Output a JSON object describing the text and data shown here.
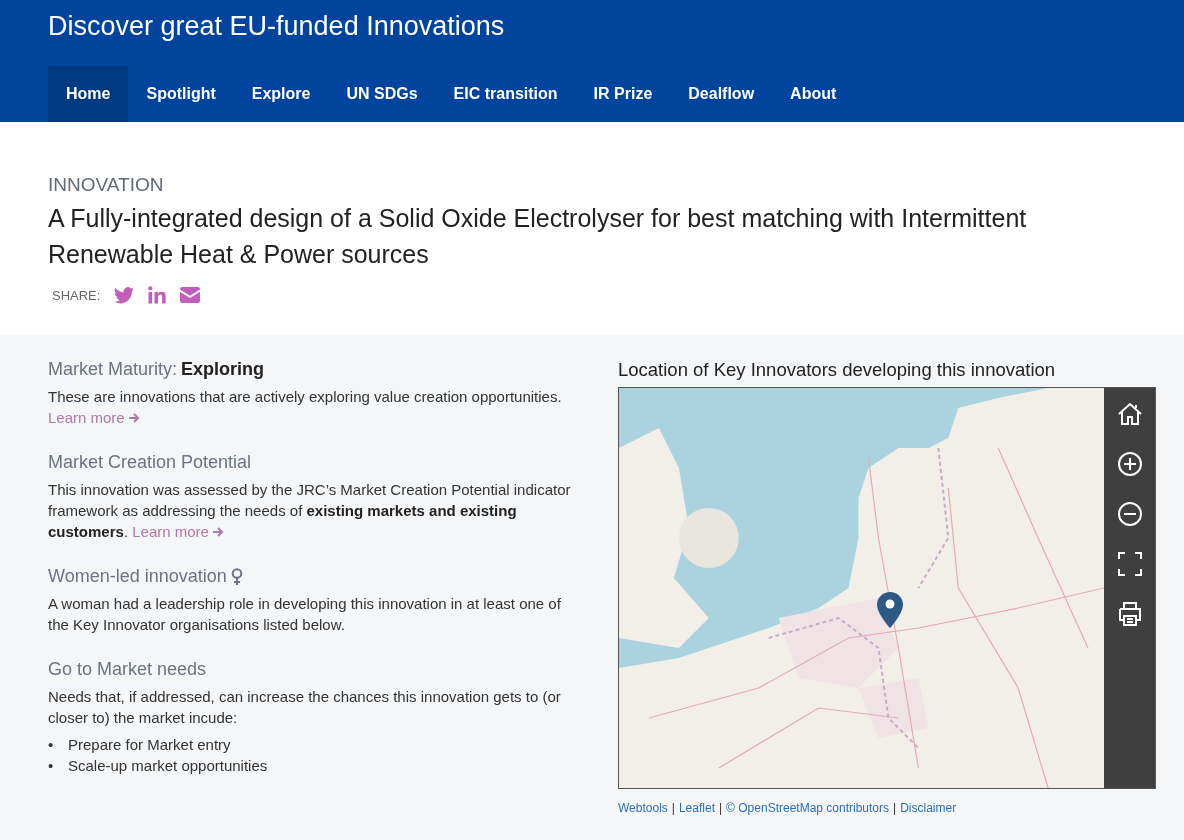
{
  "header": {
    "title": "Discover great EU-funded Innovations"
  },
  "nav": [
    {
      "label": "Home",
      "selected": true
    },
    {
      "label": "Spotlight",
      "selected": false
    },
    {
      "label": "Explore",
      "selected": false
    },
    {
      "label": "UN SDGs",
      "selected": false
    },
    {
      "label": "EIC transition",
      "selected": false
    },
    {
      "label": "IR Prize",
      "selected": false
    },
    {
      "label": "Dealflow",
      "selected": false
    },
    {
      "label": "About",
      "selected": false
    }
  ],
  "innovation": {
    "eyebrow": "INNOVATION",
    "title": "A Fully-integrated design of a Solid Oxide Electrolyser for best matching with Intermittent Renewable Heat & Power sources",
    "share_label": "SHARE:",
    "share": [
      {
        "kind": "twitter"
      },
      {
        "kind": "linkedin"
      },
      {
        "kind": "email"
      }
    ]
  },
  "sections": [
    {
      "kind": "maturity",
      "heading": "Market Maturity:",
      "value": "Exploring",
      "text": "These are innovations that are actively exploring value creation opportunities.",
      "link": "Learn more"
    },
    {
      "kind": "plain",
      "heading": "Market Creation Potential",
      "text": "This innovation was assessed by the JRC’s Market Creation Potential indicator framework as addressing the needs of **existing markets and existing customers**.",
      "link": "Learn more"
    },
    {
      "kind": "women",
      "heading": "Women-led innovation",
      "text": "A woman had a leadership role in developing this innovation in at least one of the Key Innovator organisations listed below."
    },
    {
      "kind": "plain",
      "heading": "Go to Market needs",
      "text": "Needs that, if addressed, can increase the chances this innovation gets to (or closer to) the market incude:",
      "bullet": "•",
      "bullets": [
        "Prepare for Market entry",
        "Scale-up market opportunities"
      ]
    }
  ],
  "map": {
    "title": "Location of Key Innovators developing this innovation",
    "controls": [
      {
        "kind": "home"
      },
      {
        "kind": "zoom-in"
      },
      {
        "kind": "zoom-out"
      },
      {
        "kind": "fullscreen"
      },
      {
        "kind": "print"
      }
    ],
    "separator": "|",
    "attribution": [
      "Webtools",
      "Leaflet",
      "© OpenStreetMap contributors",
      "Disclaimer"
    ]
  }
}
